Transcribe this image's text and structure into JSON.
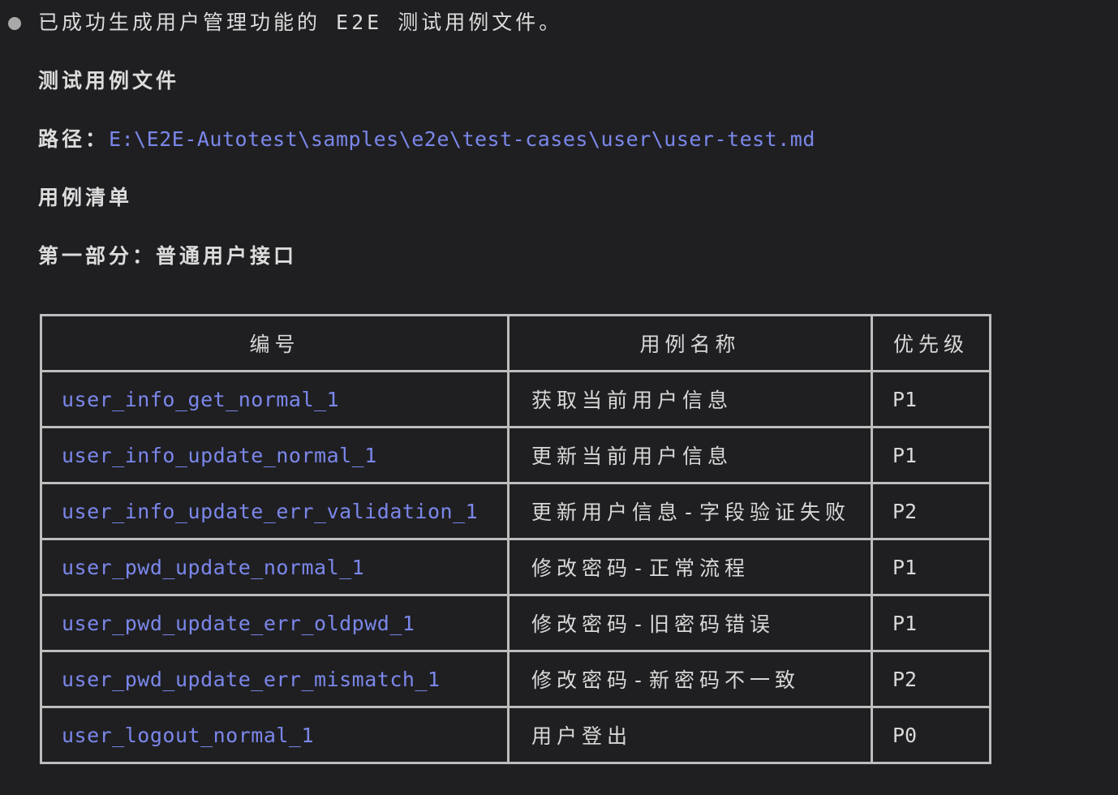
{
  "message": {
    "summary": "已成功生成用户管理功能的 E2E 测试用例文件。",
    "section_file_title": "测试用例文件",
    "path_label": "路径：",
    "path_value": "E:\\E2E-Autotest\\samples\\e2e\\test-cases\\user\\user-test.md",
    "section_list_title": "用例清单",
    "part_one_title": "第一部分：普通用户接口"
  },
  "table": {
    "headers": [
      "编号",
      "用例名称",
      "优先级"
    ],
    "rows": [
      {
        "id": "user_info_get_normal_1",
        "name": "获取当前用户信息",
        "priority": "P1"
      },
      {
        "id": "user_info_update_normal_1",
        "name": "更新当前用户信息",
        "priority": "P1"
      },
      {
        "id": "user_info_update_err_validation_1",
        "name": "更新用户信息-字段验证失败",
        "priority": "P2"
      },
      {
        "id": "user_pwd_update_normal_1",
        "name": "修改密码-正常流程",
        "priority": "P1"
      },
      {
        "id": "user_pwd_update_err_oldpwd_1",
        "name": "修改密码-旧密码错误",
        "priority": "P1"
      },
      {
        "id": "user_pwd_update_err_mismatch_1",
        "name": "修改密码-新密码不一致",
        "priority": "P2"
      },
      {
        "id": "user_logout_normal_1",
        "name": "用户登出",
        "priority": "P0"
      }
    ]
  }
}
